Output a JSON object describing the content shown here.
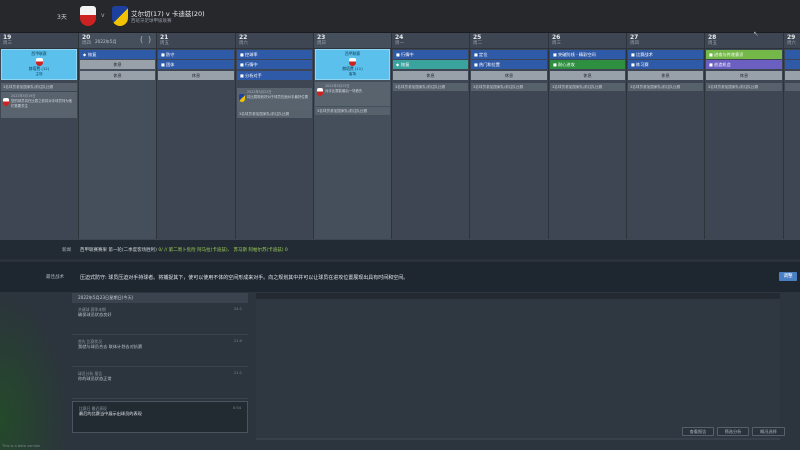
{
  "header": {
    "days_label": "3天",
    "versus": "v",
    "title": "艾尔切(17) v 卡迪兹(20)",
    "subtitle": "西班牙足球甲级联赛"
  },
  "calendar": {
    "days": [
      {
        "num": "19",
        "weekday": "周三"
      },
      {
        "num": "20",
        "weekday": "周四",
        "date": "2022年5月"
      },
      {
        "num": "21",
        "weekday": "周五"
      },
      {
        "num": "22",
        "weekday": "周六"
      },
      {
        "num": "23",
        "weekday": "周日"
      },
      {
        "num": "24",
        "weekday": "周一"
      },
      {
        "num": "25",
        "weekday": "周二"
      },
      {
        "num": "26",
        "weekday": "周三"
      },
      {
        "num": "27",
        "weekday": "周四"
      },
      {
        "num": "28",
        "weekday": "周五"
      },
      {
        "num": "29",
        "weekday": "周六"
      }
    ],
    "nav": {
      "prev": "(",
      "next": ")"
    },
    "match1": {
      "label": "西甲联赛",
      "team": "赫塔费 (12)",
      "venue": "主场"
    },
    "match2": {
      "label": "西甲联赛",
      "team": "赫塔费 (11)",
      "venue": "客场"
    },
    "d20": {
      "s1": "恢复",
      "s2": "休息",
      "s3": "休息"
    },
    "d21": {
      "s1": "防守",
      "s2": "团体",
      "s3": "休息"
    },
    "d22": {
      "s1": "控球率",
      "s2": "行情中",
      "s3": "分析对手"
    },
    "d24": {
      "s1": "行情中",
      "s2": "恢复",
      "s3": "休息"
    },
    "d25": {
      "s1": "定位",
      "s2": "热门和位置",
      "s3": "休息"
    },
    "d26": {
      "s1": "突破防线 - 精彩空间",
      "s2": "耐心进攻",
      "s3": "休息"
    },
    "d27": {
      "s1": "比赛战术",
      "s2": "练习赛",
      "s3": "休息"
    },
    "d28": {
      "s1": "进攻与传递意识",
      "s2": "创造机会",
      "s3": "休息"
    },
    "fixture_bar": "3名球员参加国家队/前往队比赛",
    "evt19": {
      "head": "2022年5月19日",
      "body": "您的球员将在比赛之前将对手球员列为他们首要关注"
    },
    "evt22": {
      "head": "2022年5月22日",
      "body": "将比赛规划好对于球员在面对手最好位置"
    },
    "evt23": {
      "head": "2022年5月23日",
      "body": "对手比赛能最后一场首先"
    }
  },
  "notes": {
    "label": "新闻",
    "text": "西甲联赛赛果 第一轮(二季度客场胜利)",
    "highlight": "0/ // 第二周卜危险 阿马拉(卡迪兹)、 苏马斯 阿帕尔苏(卡迪兹) 0"
  },
  "opponent": {
    "label": "最佳战术",
    "text": "压迫式防守: 球员压迫对手持球者。将捕捉其下，使可以使用不体的空间形成来对手。向之规划其中并可以让球员在进攻位置展现出具有时间和空间。",
    "button": "调整"
  },
  "panel": {
    "header": "2022年5月23日星期日(今天)",
    "cards": [
      {
        "title": "关键球 赛季末期",
        "desc": "确保球员状态良好",
        "right": "24:1"
      },
      {
        "title": "首先 比赛状况",
        "desc": "我就与球员合去 联体计划去对抗赛",
        "right": "21:0"
      },
      {
        "title": "球员分析 报告",
        "desc": "你的球员状态正常",
        "right": "21:1"
      },
      {
        "title": "比赛日 最近表现",
        "desc": "最后的比赛当中展示出球员的表现",
        "right": "0:54"
      }
    ],
    "buttons": {
      "b1": "查看报告",
      "b2": "筛选分析",
      "b3": "概况选择"
    }
  },
  "beta": "This is a beta version"
}
